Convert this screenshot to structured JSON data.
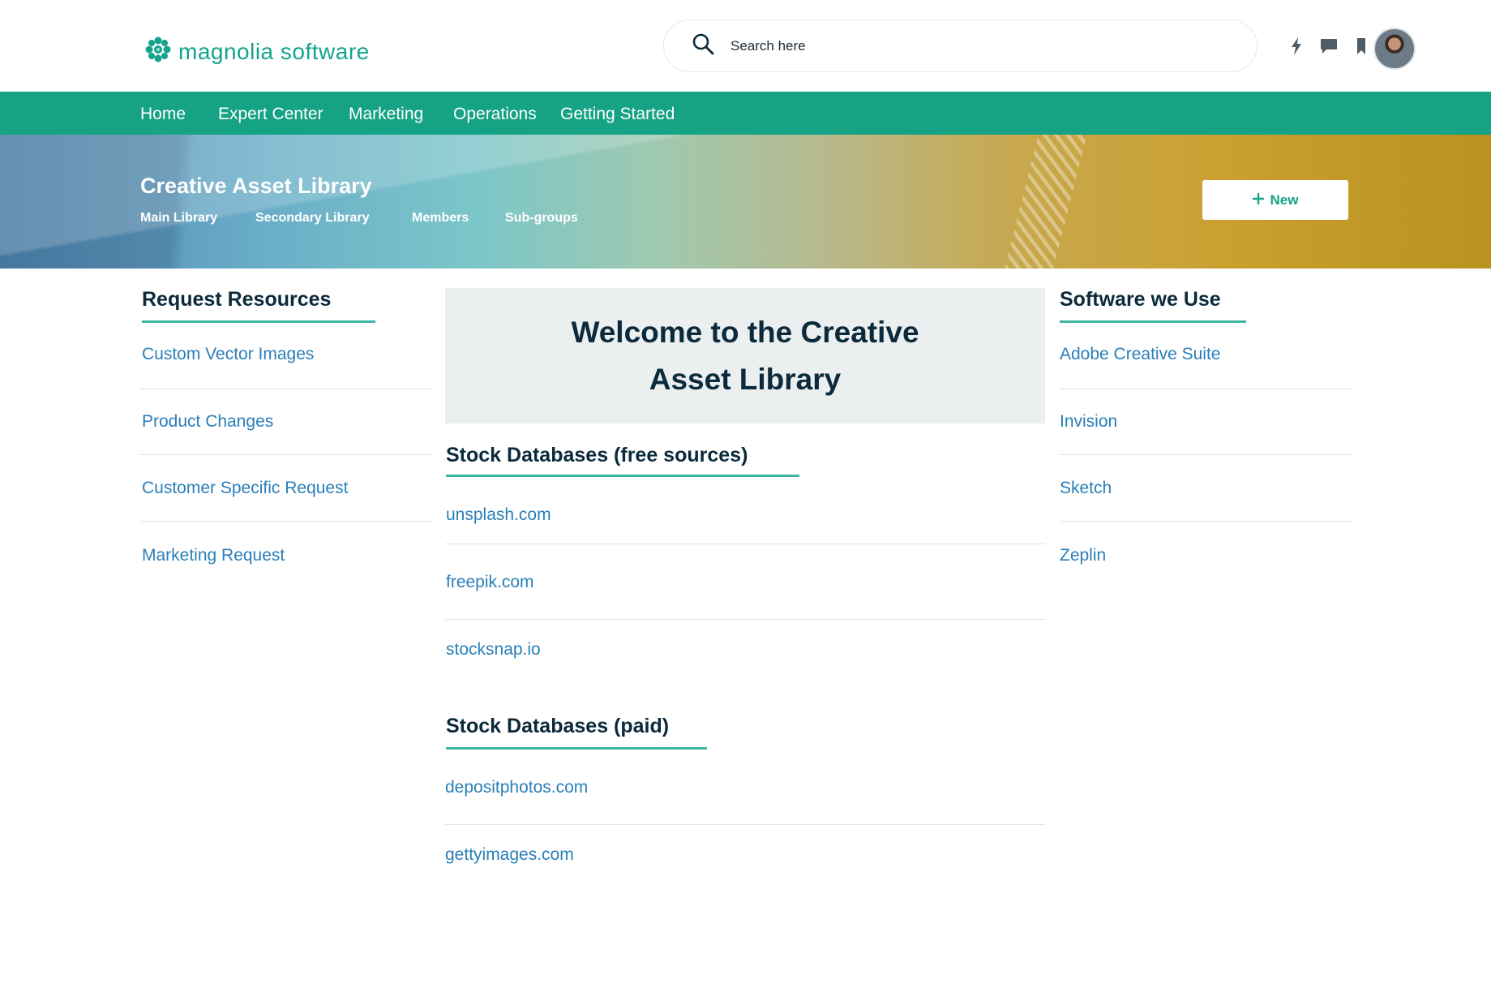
{
  "header": {
    "logo_text": "magnolia software",
    "search_placeholder": "Search here",
    "icons": [
      "bolt-icon",
      "chat-icon",
      "bookmark-icon"
    ]
  },
  "nav": {
    "items": [
      "Home",
      "Expert Center",
      "Marketing",
      "Operations",
      "Getting Started"
    ]
  },
  "banner": {
    "title": "Creative Asset Library",
    "tabs": [
      "Main Library",
      "Secondary Library",
      "Members",
      "Sub-groups"
    ],
    "new_button": "New"
  },
  "left": {
    "heading": "Request Resources",
    "links": [
      "Custom Vector Images",
      "Product Changes",
      "Customer Specific Request",
      "Marketing Request"
    ]
  },
  "center": {
    "welcome": "Welcome to the Creative Asset Library",
    "free_heading": "Stock Databases (free sources)",
    "free_links": [
      "unsplash.com",
      "freepik.com",
      "stocksnap.io"
    ],
    "paid_heading": "Stock Databases (paid)",
    "paid_links": [
      "depositphotos.com",
      "gettyimages.com"
    ]
  },
  "right": {
    "heading": "Software we Use",
    "links": [
      "Adobe Creative Suite",
      "Invision",
      "Sketch",
      "Zeplin"
    ]
  },
  "colors": {
    "brand": "#15a285",
    "link": "#2a7fb8",
    "heading": "#0b2a3c",
    "underline": "#3fb6a5"
  }
}
